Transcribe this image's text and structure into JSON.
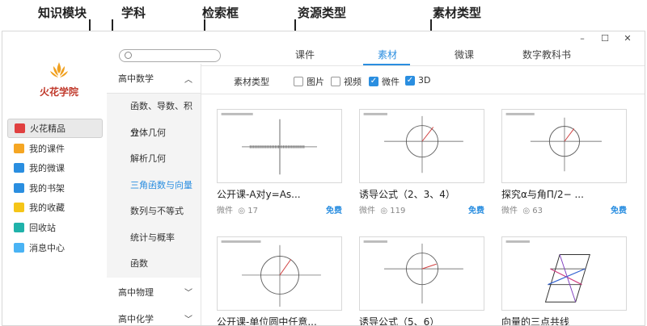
{
  "annotations": {
    "knowledge_module": "知识模块",
    "subject": "学科",
    "search_box": "检索框",
    "resource_type": "资源类型",
    "material_type": "素材类型"
  },
  "window_controls": {
    "minimize": "–",
    "maximize": "☐",
    "close": "✕"
  },
  "brand": {
    "name": "火花学院",
    "color": "#f0a020"
  },
  "nav": [
    {
      "label": "火花精品",
      "icon": "shop-icon",
      "color": "#e04040"
    },
    {
      "label": "我的课件",
      "icon": "home-icon",
      "color": "#f5a623"
    },
    {
      "label": "我的微课",
      "icon": "video-icon",
      "color": "#2a8ee0"
    },
    {
      "label": "我的书架",
      "icon": "book-icon",
      "color": "#2a8ee0"
    },
    {
      "label": "我的收藏",
      "icon": "star-icon",
      "color": "#f5c518"
    },
    {
      "label": "回收站",
      "icon": "trash-icon",
      "color": "#20b2aa"
    },
    {
      "label": "消息中心",
      "icon": "message-icon",
      "color": "#4ab3f4"
    }
  ],
  "search": {
    "placeholder": ""
  },
  "subjects": {
    "open_subject": "高中数学",
    "topics": [
      "函数、导数、积分",
      "立体几何",
      "解析几何",
      "三角函数与向量",
      "数列与不等式",
      "统计与概率",
      "函数"
    ],
    "active_topic_index": 3,
    "other_subjects": [
      "高中物理",
      "高中化学"
    ]
  },
  "tabs": [
    "课件",
    "素材",
    "微课",
    "数字教科书"
  ],
  "active_tab": "素材",
  "filter": {
    "label": "素材类型",
    "options": [
      {
        "label": "图片",
        "checked": false
      },
      {
        "label": "视频",
        "checked": false
      },
      {
        "label": "微件",
        "checked": true
      },
      {
        "label": "3D",
        "checked": true
      }
    ]
  },
  "cards": [
    {
      "title": "公开课-A对y=As...",
      "type": "微件",
      "views": "17",
      "price": "免费"
    },
    {
      "title": "诱导公式（2、3、4）",
      "type": "微件",
      "views": "119",
      "price": "免费"
    },
    {
      "title": "探究α与角Π/2− ...",
      "type": "微件",
      "views": "63",
      "price": "免费"
    },
    {
      "title": "公开课-单位圆中任意...",
      "type": "",
      "views": "",
      "price": ""
    },
    {
      "title": "诱导公式（5、6）",
      "type": "",
      "views": "",
      "price": ""
    },
    {
      "title": "向量的三点共线",
      "type": "",
      "views": "",
      "price": ""
    }
  ]
}
